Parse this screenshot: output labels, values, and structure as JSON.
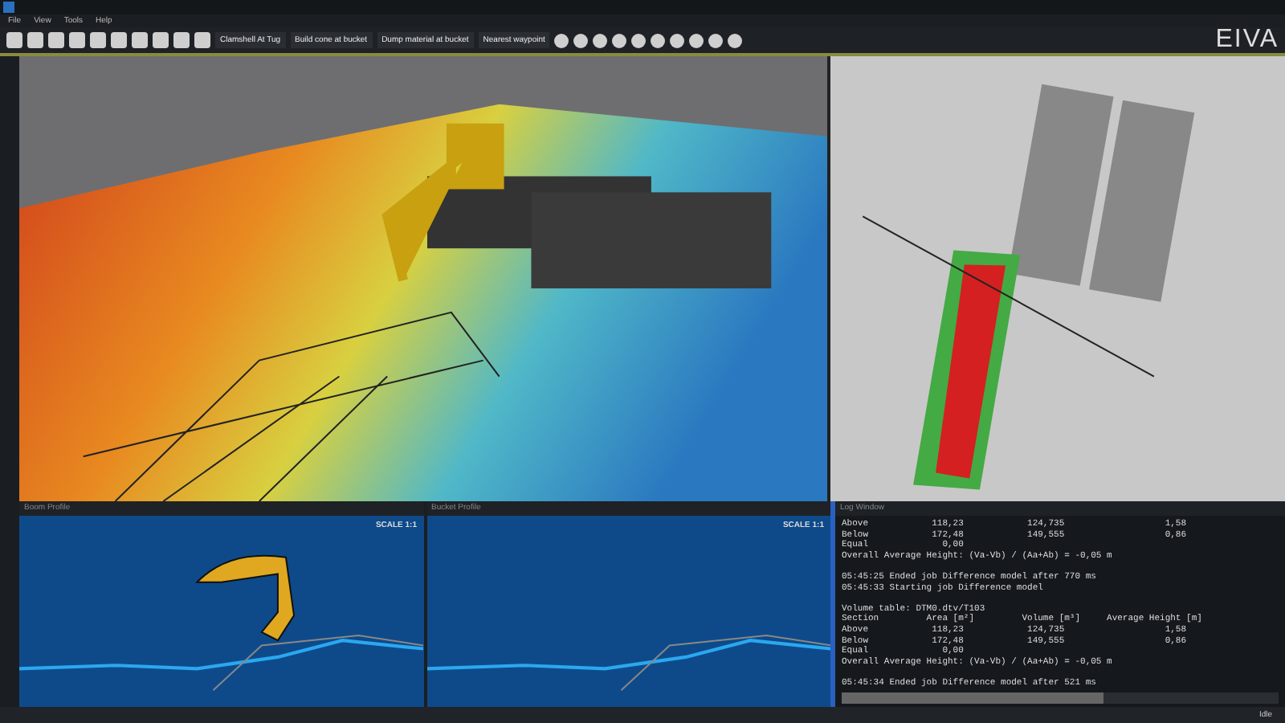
{
  "menu": [
    "File",
    "View",
    "Tools",
    "Help"
  ],
  "toolbar": {
    "buttons": [
      {
        "label": "Clamshell At Tug"
      },
      {
        "label": "Build cone at bucket"
      },
      {
        "label": "Dump material at bucket"
      },
      {
        "label": "Nearest waypoint"
      }
    ]
  },
  "logo": "EIVA",
  "panels": [
    {
      "title": "Boom Profile",
      "scale": "SCALE 1:1"
    },
    {
      "title": "Bucket Profile",
      "scale": "SCALE 1:1"
    }
  ],
  "log": {
    "title": "Log Window",
    "blocks": [
      [
        "Above            118,23            124,735                   1,58",
        "Below            172,48            149,555                   0,86",
        "Equal              0,00",
        "Overall Average Height: (Va-Vb) / (Aa+Ab) = -0,05 m"
      ],
      [
        "05:45:25 Ended job Difference model after 770 ms",
        "05:45:33 Starting job Difference model"
      ],
      [
        "Volume table: DTM0.dtv/T103",
        "Section         Area [m²]         Volume [m³]     Average Height [m]",
        "Above            118,23            124,735                   1,58",
        "Below            172,48            149,555                   0,86",
        "Equal              0,00",
        "Overall Average Height: (Va-Vb) / (Aa+Ab) = -0,05 m"
      ],
      [
        "05:45:34 Ended job Difference model after 521 ms"
      ]
    ]
  },
  "status_bar": {
    "state": "Idle"
  }
}
